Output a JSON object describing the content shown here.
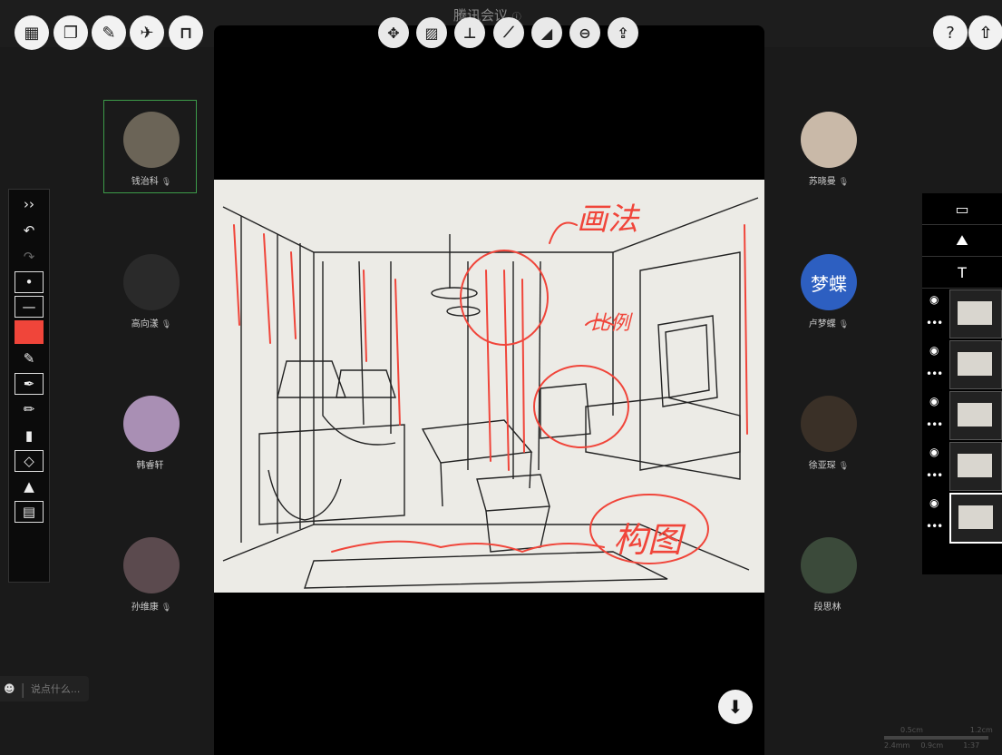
{
  "header": {
    "title": "腾讯会议",
    "info_icon": "info-icon",
    "left_buttons": [
      "grid-icon",
      "window-icon",
      "wrench-icon",
      "satellite-icon",
      "frame-icon"
    ],
    "whiteboard_tools": [
      "move-icon",
      "hatch-icon",
      "axis-icon",
      "ruler-icon",
      "triangle-icon",
      "minus-circle-icon",
      "upload-icon"
    ],
    "right_buttons": {
      "help": "?",
      "share": "share-icon"
    }
  },
  "participants_left": [
    {
      "name": "钱治科",
      "mic": "🎙",
      "active": true
    },
    {
      "name": "高向漾",
      "mic": "🎙"
    },
    {
      "name": "韩睿轩",
      "mic": ""
    },
    {
      "name": "孙维康",
      "mic": "🎙"
    }
  ],
  "participants_right": [
    {
      "name": "苏晓曼",
      "mic": "🎙"
    },
    {
      "name": "卢梦蝶",
      "mic": "🎙",
      "avatar_text": "梦蝶"
    },
    {
      "name": "徐亚琛",
      "mic": "🎙"
    },
    {
      "name": "段思林",
      "mic": ""
    }
  ],
  "annotations": {
    "a1": "画法",
    "a2": "比例",
    "a3": "构图"
  },
  "toolbar_left": {
    "expand": "››",
    "undo": "↶",
    "redo": "↷",
    "color": "#f0453a"
  },
  "chat": {
    "placeholder": "说点什么..."
  },
  "pages_panel": {
    "page_count": 5,
    "selected_index": 4
  },
  "scale_bar": {
    "left_top": "0.5cm",
    "right_top": "1.2cm",
    "left_bottom": "2.4mm",
    "mid_bottom": "0.9cm",
    "right_bottom": "1:37"
  },
  "colors": {
    "accent_green": "#3c9b49",
    "annotation_red": "#f0453a",
    "avatar_blue": "#2d5fc1"
  }
}
